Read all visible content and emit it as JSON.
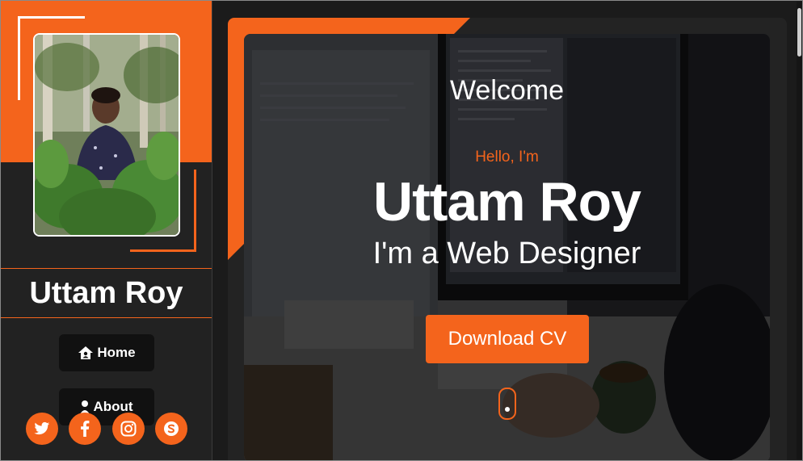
{
  "sidebar": {
    "name": "Uttam Roy",
    "nav": [
      {
        "label": "Home",
        "icon": "home-icon"
      },
      {
        "label": "About",
        "icon": "user-icon"
      }
    ],
    "social": [
      "twitter-icon",
      "facebook-icon",
      "instagram-icon",
      "skype-icon"
    ]
  },
  "hero": {
    "welcome": "Welcome",
    "greeting": "Hello, I'm",
    "name": "Uttam Roy",
    "role": "I'm a Web Designer",
    "cta": "Download CV"
  },
  "colors": {
    "accent": "#f4641c",
    "background": "#1b1b1b",
    "sidebar": "#222222"
  }
}
